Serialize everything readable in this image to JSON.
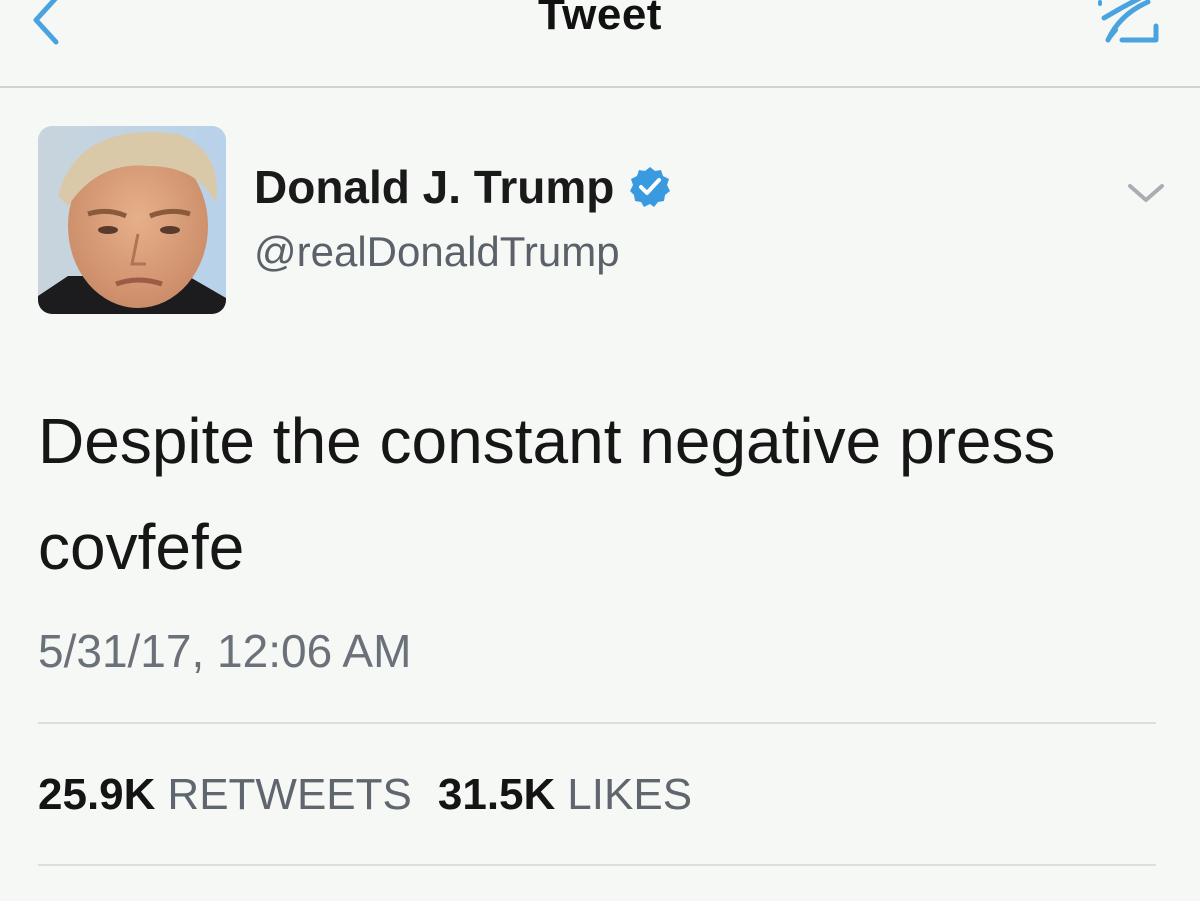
{
  "navbar": {
    "title": "Tweet",
    "back_icon": "chevron-left-icon",
    "compose_icon": "compose-tweet-icon",
    "accent_color": "#4aa3df"
  },
  "tweet": {
    "display_name": "Donald J. Trump",
    "verified_icon": "verified-badge-icon",
    "verified_color": "#3a9ae0",
    "handle": "@realDonaldTrump",
    "caret_icon": "chevron-down-icon",
    "text_lines": [
      "Despite the constant negative press",
      "covfefe"
    ],
    "timestamp": "5/31/17, 12:06 AM"
  },
  "stats": {
    "retweets_count": "25.9K",
    "retweets_label": "RETWEETS",
    "likes_count": "31.5K",
    "likes_label": "LIKES"
  }
}
